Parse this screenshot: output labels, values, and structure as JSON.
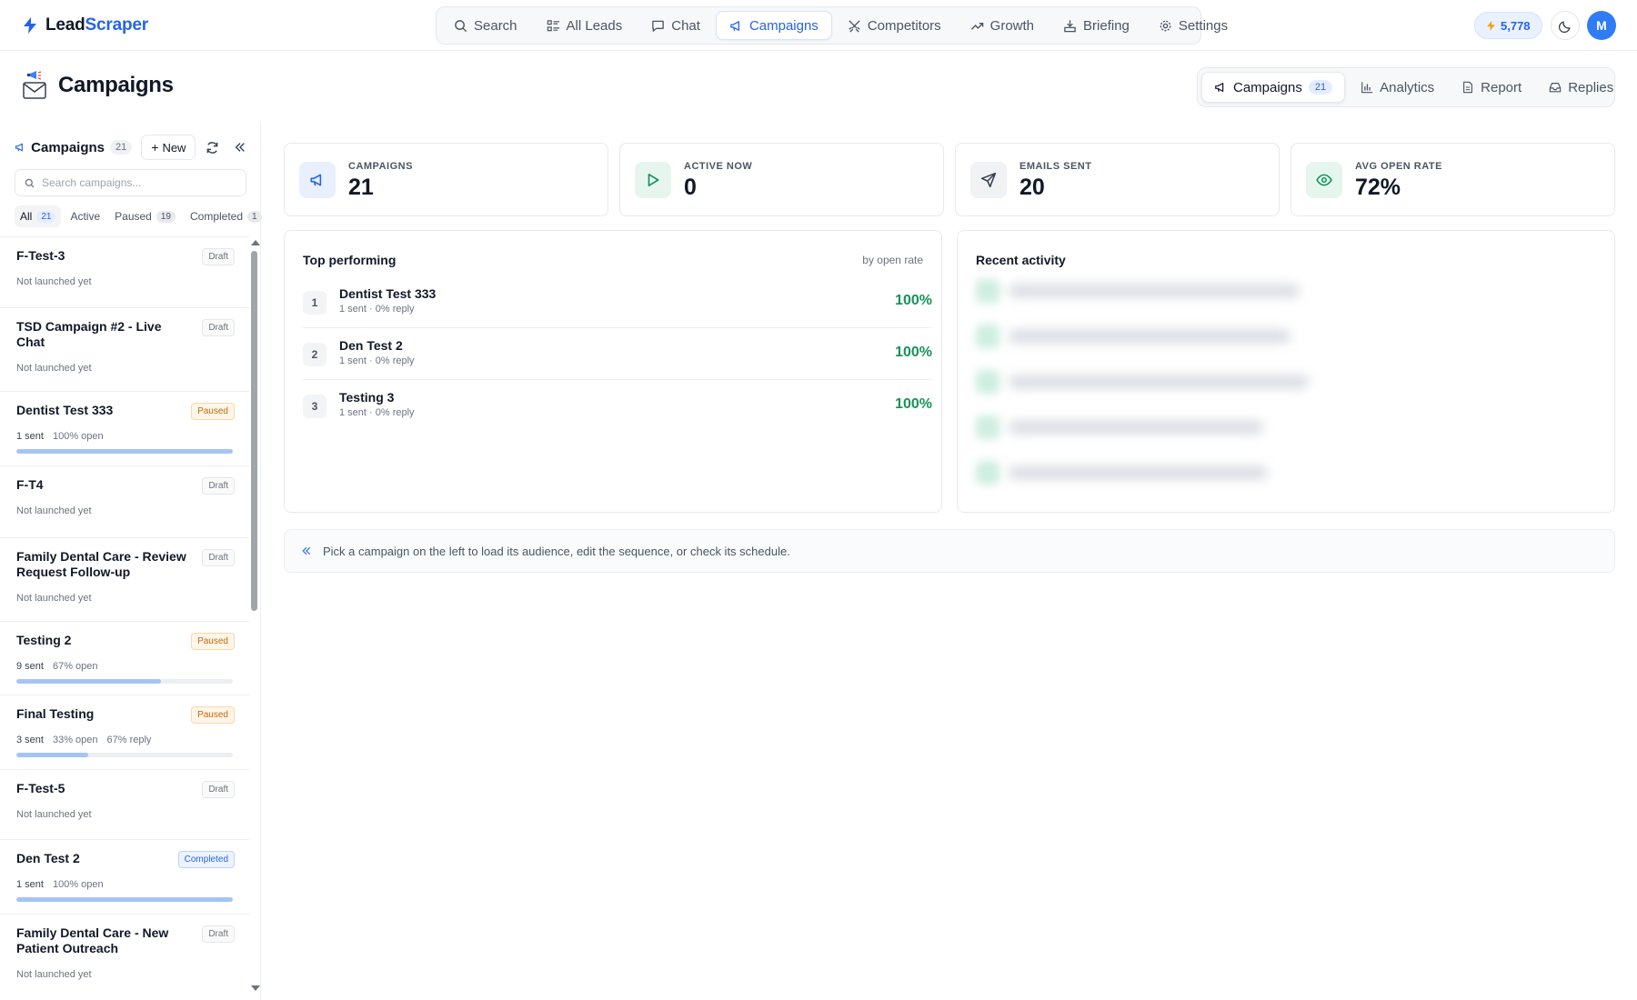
{
  "app": {
    "brand_part1": "Lead",
    "brand_part2": "Scraper",
    "credits": "5,778",
    "avatar_initial": "M"
  },
  "nav": [
    {
      "label": "Search",
      "icon": "search-icon"
    },
    {
      "label": "All Leads",
      "icon": "list-icon"
    },
    {
      "label": "Chat",
      "icon": "chat-icon"
    },
    {
      "label": "Campaigns",
      "icon": "megaphone-icon",
      "active": true
    },
    {
      "label": "Competitors",
      "icon": "swords-icon"
    },
    {
      "label": "Growth",
      "icon": "trending-up-icon"
    },
    {
      "label": "Briefing",
      "icon": "briefing-icon"
    },
    {
      "label": "Settings",
      "icon": "gear-icon"
    }
  ],
  "page": {
    "title": "Campaigns"
  },
  "subtabs": [
    {
      "label": "Campaigns",
      "count": "21",
      "icon": "megaphone-icon",
      "active": true
    },
    {
      "label": "Analytics",
      "icon": "bar-chart-icon"
    },
    {
      "label": "Report",
      "icon": "document-icon"
    },
    {
      "label": "Replies",
      "icon": "inbox-icon"
    }
  ],
  "sidebar": {
    "title": "Campaigns",
    "count": "21",
    "new_label": "New",
    "search_placeholder": "Search campaigns...",
    "filters": [
      {
        "label": "All",
        "count": "21",
        "active": true
      },
      {
        "label": "Active",
        "count": ""
      },
      {
        "label": "Paused",
        "count": "19"
      },
      {
        "label": "Completed",
        "count": "1"
      }
    ],
    "items": [
      {
        "name": "F-Test-3",
        "status": "Draft",
        "kind": "draft",
        "meta": "Not launched yet"
      },
      {
        "name": "TSD Campaign #2 - Live Chat",
        "status": "Draft",
        "kind": "draft",
        "meta": "Not launched yet"
      },
      {
        "name": "Dentist Test 333",
        "status": "Paused",
        "kind": "paused",
        "sent": "1 sent",
        "open": "100% open",
        "reply": "",
        "progress": 1.0
      },
      {
        "name": "F-T4",
        "status": "Draft",
        "kind": "draft",
        "meta": "Not launched yet"
      },
      {
        "name": "Family Dental Care - Review Request Follow-up",
        "status": "Draft",
        "kind": "draft",
        "meta": "Not launched yet"
      },
      {
        "name": "Testing 2",
        "status": "Paused",
        "kind": "paused",
        "sent": "9 sent",
        "open": "67% open",
        "reply": "",
        "progress": 0.67
      },
      {
        "name": "Final Testing",
        "status": "Paused",
        "kind": "paused",
        "sent": "3 sent",
        "open": "33% open",
        "reply": "67% reply",
        "progress": 0.33
      },
      {
        "name": "F-Test-5",
        "status": "Draft",
        "kind": "draft",
        "meta": "Not launched yet"
      },
      {
        "name": "Den Test 2",
        "status": "Completed",
        "kind": "completed",
        "sent": "1 sent",
        "open": "100% open",
        "reply": "",
        "progress": 1.0
      },
      {
        "name": "Family Dental Care - New Patient Outreach",
        "status": "Draft",
        "kind": "draft",
        "meta": "Not launched yet"
      }
    ]
  },
  "stats": [
    {
      "label": "CAMPAIGNS",
      "value": "21",
      "icon": "megaphone-icon",
      "bg": "#e8f0fd",
      "fg": "#2563eb"
    },
    {
      "label": "ACTIVE NOW",
      "value": "0",
      "icon": "play-icon",
      "bg": "#e6f6ee",
      "fg": "#16935a"
    },
    {
      "label": "EMAILS SENT",
      "value": "20",
      "icon": "send-icon",
      "bg": "#f1f2f4",
      "fg": "#374151"
    },
    {
      "label": "AVG OPEN RATE",
      "value": "72%",
      "icon": "eye-icon",
      "bg": "#e6f6ee",
      "fg": "#16935a"
    }
  ],
  "top_performing": {
    "title": "Top performing",
    "subtitle": "by open rate",
    "rows": [
      {
        "rank": "1",
        "name": "Dentist Test 333",
        "meta": "1 sent · 0% reply",
        "rate": "100%"
      },
      {
        "rank": "2",
        "name": "Den Test 2",
        "meta": "1 sent · 0% reply",
        "rate": "100%"
      },
      {
        "rank": "3",
        "name": "Testing 3",
        "meta": "1 sent · 0% reply",
        "rate": "100%"
      }
    ]
  },
  "recent_activity": {
    "title": "Recent activity"
  },
  "hint": {
    "text": "Pick a campaign on the left to load its audience, edit the sequence, or check its schedule."
  },
  "colors": {
    "accent": "#2563eb",
    "success": "#16935a",
    "paused": "#c2690f"
  }
}
